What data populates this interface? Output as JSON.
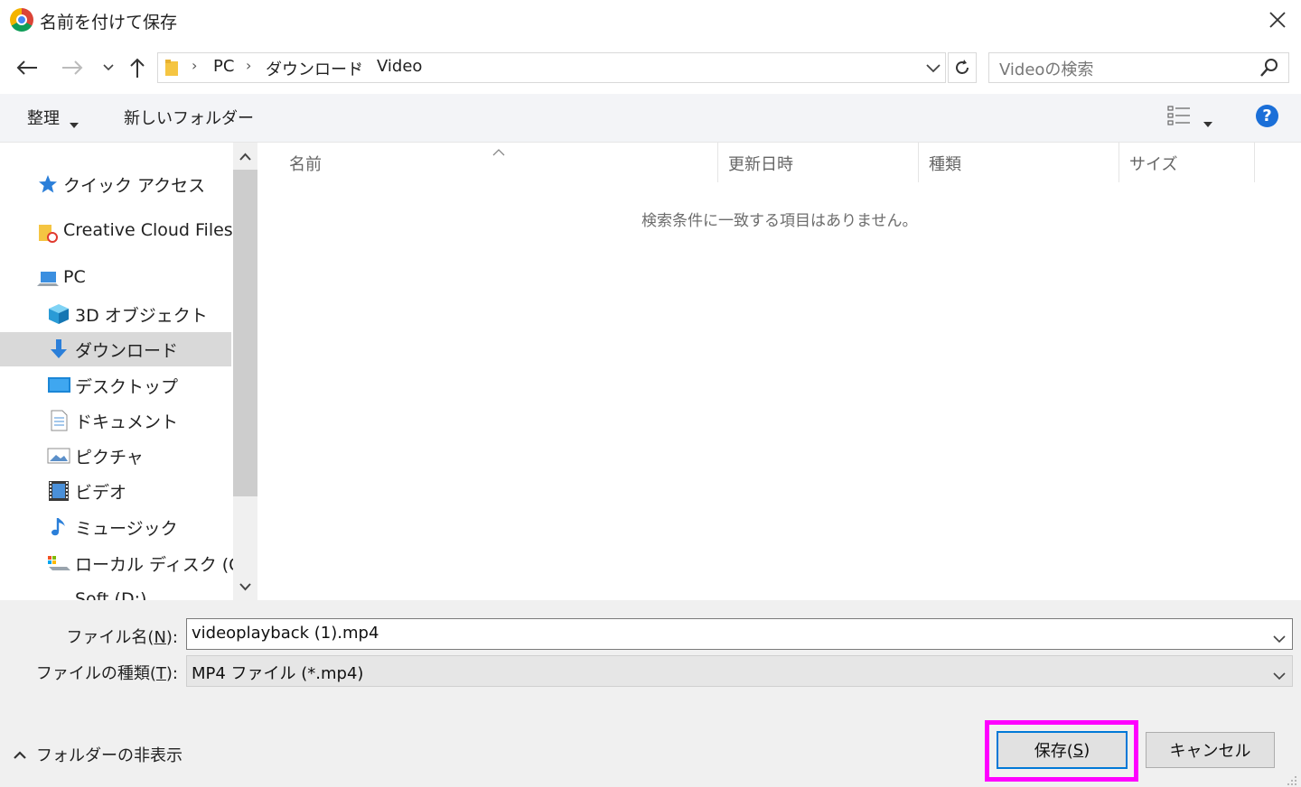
{
  "window": {
    "title": "名前を付けて保存"
  },
  "address": {
    "crumbs": [
      "PC",
      "ダウンロード",
      "Video"
    ],
    "search_placeholder": "Videoの検索"
  },
  "toolbar": {
    "organize_label": "整理",
    "new_folder_label": "新しいフォルダー",
    "help_label": "?"
  },
  "sidebar": {
    "items": [
      {
        "label": "クイック アクセス",
        "icon": "star-icon"
      },
      {
        "label": "Creative Cloud Files",
        "icon": "creative-cloud-folder-icon"
      },
      {
        "label": "PC",
        "icon": "computer-icon"
      },
      {
        "label": "3D オブジェクト",
        "icon": "3d-objects-icon"
      },
      {
        "label": "ダウンロード",
        "icon": "download-arrow-icon",
        "selected": true
      },
      {
        "label": "デスクトップ",
        "icon": "desktop-icon"
      },
      {
        "label": "ドキュメント",
        "icon": "document-icon"
      },
      {
        "label": "ピクチャ",
        "icon": "pictures-icon"
      },
      {
        "label": "ビデオ",
        "icon": "video-film-icon"
      },
      {
        "label": "ミュージック",
        "icon": "music-note-icon"
      },
      {
        "label": "ローカル ディスク (C:)",
        "icon": "local-disk-icon"
      },
      {
        "label": "Soft (D:)",
        "icon": "drive-icon"
      }
    ]
  },
  "filelist": {
    "columns": [
      "名前",
      "更新日時",
      "種類",
      "サイズ"
    ],
    "empty_message": "検索条件に一致する項目はありません。"
  },
  "form": {
    "filename_label_pre": "ファイル名(",
    "filename_label_key": "N",
    "filename_label_post": "):",
    "filename_value": "videoplayback (1).mp4",
    "filetype_label_pre": "ファイルの種類(",
    "filetype_label_key": "T",
    "filetype_label_post": "):",
    "filetype_value": "MP4 ファイル (*.mp4)"
  },
  "footer": {
    "hide_folders_label": "フォルダーの非表示",
    "save_label_pre": "保存(",
    "save_label_key": "S",
    "save_label_post": ")",
    "cancel_label": "キャンセル"
  },
  "colors": {
    "highlight": "#ff00ff",
    "accent": "#0078d7",
    "help": "#1b6fd8"
  }
}
